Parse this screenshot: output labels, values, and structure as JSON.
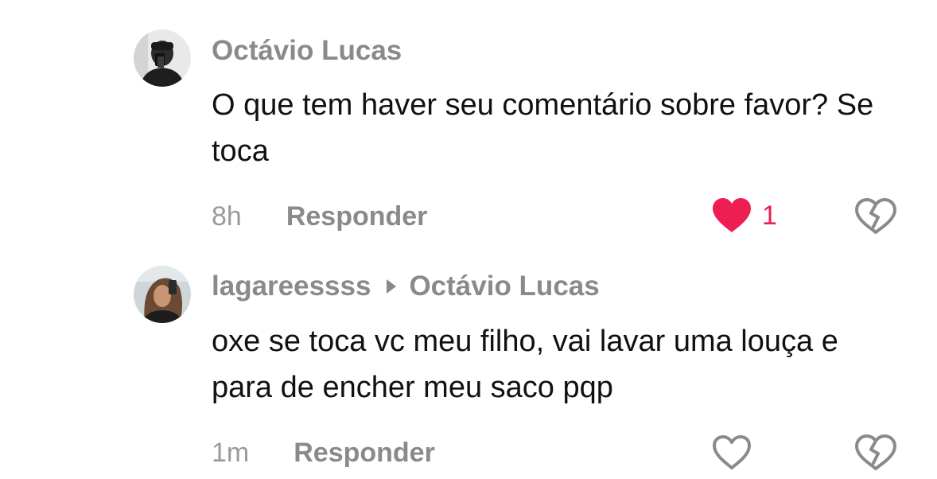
{
  "comments": [
    {
      "author": "Octávio Lucas",
      "text": "O que tem haver seu comentário sobre favor? Se toca",
      "time": "8h",
      "reply_label": "Responder",
      "likes": "1",
      "liked": true
    },
    {
      "author": "lagareessss",
      "reply_to": "Octávio Lucas",
      "text": "oxe se toca vc meu filho, vai lavar uma louça e para de encher meu saco pqp",
      "time": "1m",
      "reply_label": "Responder",
      "liked": false
    }
  ],
  "colors": {
    "like_active": "#ee1d52",
    "secondary_text": "#8a8a8a",
    "primary_text": "#111111"
  }
}
